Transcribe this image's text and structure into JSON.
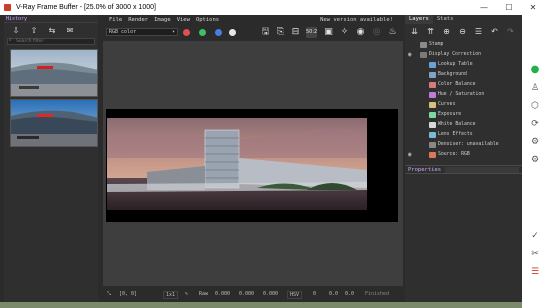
{
  "window": {
    "title": "V-Ray Frame Buffer - [25.0% of 3000 x 1000]",
    "controls": [
      "—",
      "☐",
      "✕"
    ]
  },
  "history": {
    "header": "History",
    "search_placeholder": "Search filter"
  },
  "menu": {
    "items": [
      "File",
      "Render",
      "Image",
      "View",
      "Options"
    ],
    "notice": "New version available!"
  },
  "toolbar": {
    "channel": "RGB color",
    "zoom_label": "50:2",
    "colors": {
      "red": "#e05050",
      "green": "#40c060",
      "blue": "#4a7ee0",
      "white": "#e6e6e6"
    }
  },
  "status": {
    "coords": "[0, 0]",
    "mode": "1x1",
    "raw_label": "Raw",
    "r": "0.000",
    "g": "0.000",
    "b": "0.000",
    "color_space": "HSV",
    "h": "0",
    "s": "0.0",
    "v": "0.0",
    "finished": "Finished"
  },
  "layers": {
    "tabs": [
      "Layers",
      "Stats"
    ],
    "items": [
      {
        "label": "Stamp",
        "color": "#8a8a8a"
      },
      {
        "label": "Display Correction",
        "color": "#7a7a7a"
      },
      {
        "label": "Lookup Table",
        "color": "#6aa0d8"
      },
      {
        "label": "Background",
        "color": "#7fa2c8"
      },
      {
        "label": "Color Balance",
        "color": "#d87a7a"
      },
      {
        "label": "Hue / Saturation",
        "color": "#c07ad8"
      },
      {
        "label": "Curves",
        "color": "#d8c07a"
      },
      {
        "label": "Exposure",
        "color": "#7ad8a0"
      },
      {
        "label": "White Balance",
        "color": "#d8d8d8"
      },
      {
        "label": "Lens Effects",
        "color": "#7ab8d8"
      },
      {
        "label": "Denoiser: unavailable",
        "color": "#888888"
      },
      {
        "label": "Source: RGB",
        "color": "#d87a5a"
      }
    ],
    "properties_label": "Properties"
  }
}
